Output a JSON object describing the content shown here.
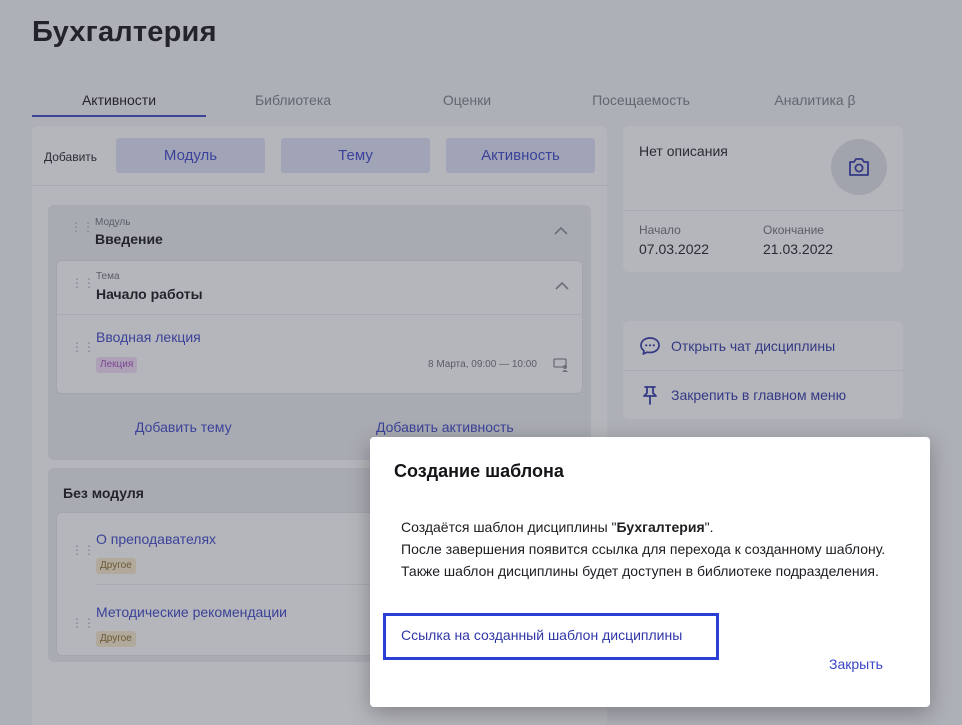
{
  "page": {
    "title": "Бухгалтерия"
  },
  "tabs": [
    {
      "label": "Активности",
      "active": true
    },
    {
      "label": "Библиотека",
      "active": false
    },
    {
      "label": "Оценки",
      "active": false
    },
    {
      "label": "Посещаемость",
      "active": false
    },
    {
      "label": "Аналитика β",
      "active": false
    }
  ],
  "add_bar": {
    "label": "Добавить",
    "buttons": [
      "Модуль",
      "Тему",
      "Активность"
    ]
  },
  "module": {
    "caption": "Модуль",
    "title": "Введение",
    "topic": {
      "caption": "Тема",
      "title": "Начало работы",
      "activities": [
        {
          "name": "Вводная лекция",
          "badge": "Лекция",
          "schedule": "8 Марта, 09:00 — 10:00"
        }
      ]
    },
    "add_topic": "Добавить тему",
    "add_activity": "Добавить активность"
  },
  "no_module": {
    "title": "Без модуля",
    "activities": [
      {
        "name": "О преподавателях",
        "badge": "Другое"
      },
      {
        "name": "Методические рекомендации",
        "badge": "Другое"
      }
    ]
  },
  "info": {
    "description": "Нет описания",
    "start_label": "Начало",
    "start_value": "07.03.2022",
    "end_label": "Окончание",
    "end_value": "21.03.2022"
  },
  "actions": {
    "open_chat": "Открыть чат дисциплины",
    "pin_menu": "Закрепить в главном меню"
  },
  "modal": {
    "title": "Создание шаблона",
    "body_prefix": "Создаётся шаблон дисциплины \"",
    "body_name": "Бухгалтерия",
    "body_suffix": "\".",
    "body_rest": "После завершения появится ссылка для перехода к созданному шаблону. Также шаблон дисциплины будет доступен в библиотеке подразделения.",
    "link": "Ссылка на созданный шаблон дисциплины",
    "close": "Закрыть"
  },
  "colors": {
    "accent": "#3a45c8",
    "focus_outline": "#2a3fd6",
    "lecture_badge": "#f3defa",
    "other_badge": "#f7ebcd"
  }
}
